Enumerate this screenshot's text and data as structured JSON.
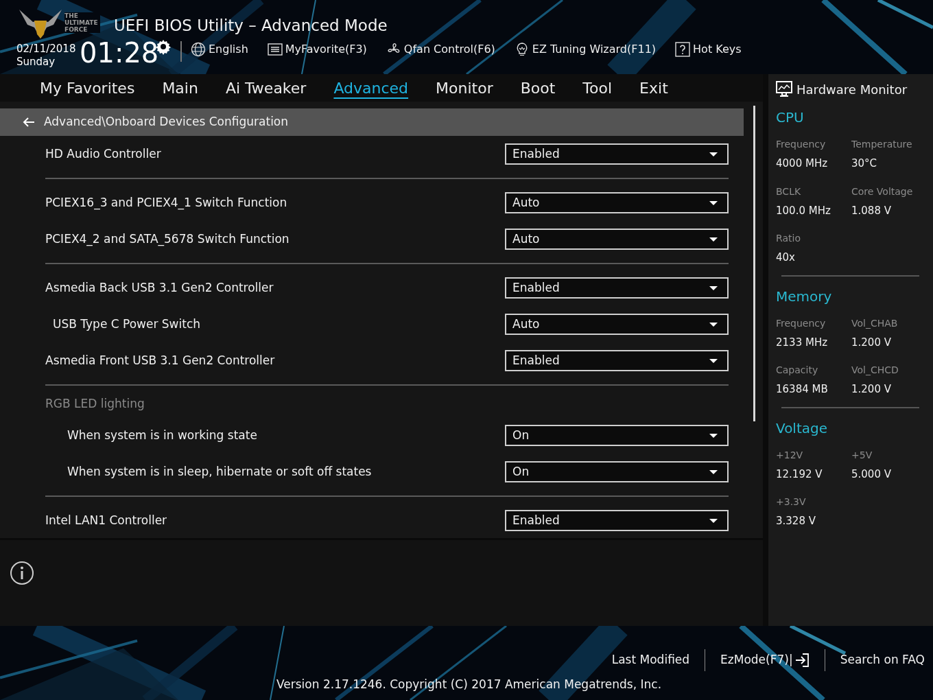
{
  "header": {
    "logo_text": "THE ULTIMATE FORCE",
    "title": "UEFI BIOS Utility – Advanced Mode",
    "date": "02/11/2018",
    "day": "Sunday",
    "time": "01:28",
    "tools": [
      {
        "kind": "globe",
        "label": "English"
      },
      {
        "kind": "list",
        "label": "MyFavorite(F3)"
      },
      {
        "kind": "fan",
        "label": "Qfan Control(F6)"
      },
      {
        "kind": "bulb",
        "label": "EZ Tuning Wizard(F11)"
      },
      {
        "kind": "help",
        "label": "Hot Keys"
      }
    ]
  },
  "menu": [
    {
      "label": "My Favorites",
      "selected": false
    },
    {
      "label": "Main",
      "selected": false
    },
    {
      "label": "Ai Tweaker",
      "selected": false
    },
    {
      "label": "Advanced",
      "selected": true
    },
    {
      "label": "Monitor",
      "selected": false
    },
    {
      "label": "Boot",
      "selected": false
    },
    {
      "label": "Tool",
      "selected": false
    },
    {
      "label": "Exit",
      "selected": false
    }
  ],
  "breadcrumb": "Advanced\\Onboard Devices Configuration",
  "groups": [
    [
      {
        "kind": "setting",
        "label": "HD Audio Controller",
        "value": "Enabled"
      }
    ],
    [
      {
        "kind": "setting",
        "label": "PCIEX16_3 and PCIEX4_1 Switch Function",
        "value": "Auto"
      },
      {
        "kind": "setting",
        "label": "PCIEX4_2 and SATA_5678 Switch Function",
        "value": "Auto"
      }
    ],
    [
      {
        "kind": "setting",
        "label": "Asmedia Back USB 3.1 Gen2 Controller",
        "value": "Enabled",
        "children": [
          {
            "kind": "setting",
            "label": "USB Type C Power Switch",
            "value": "Auto"
          }
        ]
      },
      {
        "kind": "setting",
        "label": "Asmedia Front USB 3.1 Gen2 Controller",
        "value": "Enabled"
      }
    ],
    [
      {
        "kind": "heading",
        "label": "RGB LED lighting",
        "children": [
          {
            "kind": "setting",
            "label": "When system is in working state",
            "value": "On"
          },
          {
            "kind": "setting",
            "label": "When system is in sleep, hibernate or soft off states",
            "value": "On"
          }
        ]
      }
    ],
    [
      {
        "kind": "setting",
        "label": "Intel LAN1 Controller",
        "value": "Enabled"
      }
    ]
  ],
  "monitor": {
    "title": "Hardware Monitor",
    "sections": [
      {
        "title": "CPU",
        "items": [
          {
            "label": "Frequency",
            "value": "4000 MHz"
          },
          {
            "label": "Temperature",
            "value": "30°C"
          },
          {
            "label": "BCLK",
            "value": "100.0 MHz"
          },
          {
            "label": "Core Voltage",
            "value": "1.088 V"
          },
          {
            "label": "Ratio",
            "value": "40x"
          }
        ]
      },
      {
        "title": "Memory",
        "items": [
          {
            "label": "Frequency",
            "value": "2133 MHz"
          },
          {
            "label": "Vol_CHAB",
            "value": "1.200 V"
          },
          {
            "label": "Capacity",
            "value": "16384 MB"
          },
          {
            "label": "Vol_CHCD",
            "value": "1.200 V"
          }
        ]
      },
      {
        "title": "Voltage",
        "items": [
          {
            "label": "+12V",
            "value": "12.192 V"
          },
          {
            "label": "+5V",
            "value": "5.000 V"
          },
          {
            "label": "+3.3V",
            "value": "3.328 V"
          }
        ]
      }
    ]
  },
  "footer": {
    "links": [
      {
        "kind": "text",
        "label": "Last Modified"
      },
      {
        "kind": "exit",
        "label": "EzMode(F7)|"
      },
      {
        "kind": "text",
        "label": "Search on FAQ"
      }
    ],
    "version": "Version 2.17.1246. Copyright (C) 2017 American Megatrends, Inc."
  }
}
